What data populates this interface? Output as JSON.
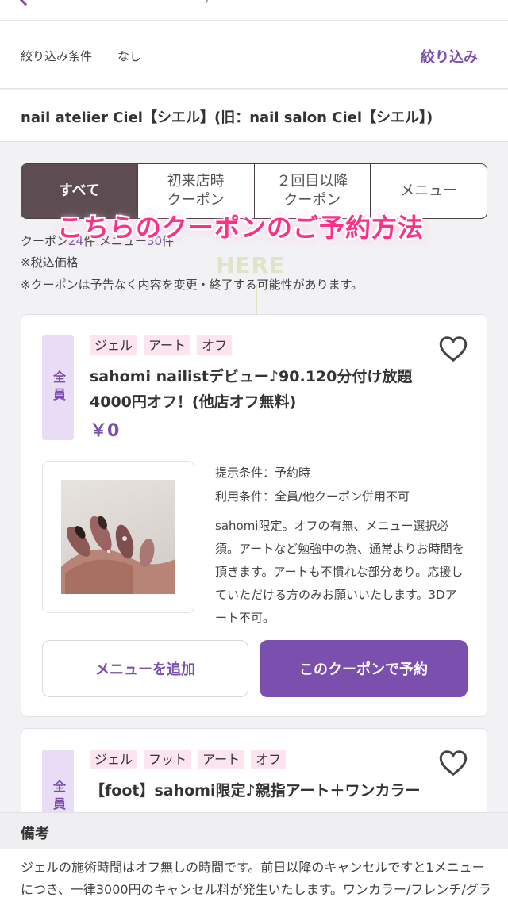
{
  "filter": {
    "label": "絞り込み条件",
    "value": "なし",
    "button": "絞り込み"
  },
  "salon": {
    "name": "nail atelier Ciel【シエル】(旧：nail salon Ciel【シエル】)"
  },
  "tabs": [
    {
      "label": "すべて",
      "active": true
    },
    {
      "label": "初来店時\nクーポン",
      "active": false
    },
    {
      "label": "２回目以降\nクーポン",
      "active": false
    },
    {
      "label": "メニュー",
      "active": false
    }
  ],
  "overlay": {
    "caption": "こちらのクーポンのご予約方法",
    "pointer": "HERE"
  },
  "counts": {
    "coupon_label": "クーポン",
    "coupon_num": "24",
    "coupon_unit": "件",
    "menu_label": "メニュー",
    "menu_num": "30",
    "menu_unit": "件"
  },
  "notes": [
    "※税込価格",
    "※クーポンは予告なく内容を変更・終了する可能性があります。"
  ],
  "coupons": [
    {
      "badge": "全員",
      "tags": [
        "ジェル",
        "アート",
        "オフ"
      ],
      "title": "sahomi nailistデビュー♪90.120分付け放題4000円オフ！(他店オフ無料)",
      "price": "￥0",
      "present_condition": "提示条件：予約時",
      "use_condition": "利用条件：全員/他クーポン併用不可",
      "description": "sahomi限定。オフの有無、メニュー選択必須。アートなど勉強中の為、通常よりお時間を頂きます。アートも不慣れな部分あり。応援していただける方のみお願いいたします。3Dアート不可。",
      "add_button": "メニューを追加",
      "reserve_button": "このクーポンで予約"
    },
    {
      "badge": "全員",
      "tags": [
        "ジェル",
        "フット",
        "アート",
        "オフ"
      ],
      "title": "【foot】sahomi限定♪親指アート＋ワンカラー"
    }
  ],
  "remarks": {
    "title": "備考",
    "text": "ジェルの施術時間はオフ無しの時間です。前日以降のキャンセルですと1メニューにつき、一律3000円のキャンセル料が発生いたします。ワンカラー/フレンチ/グラデーション/ニュアンス/パラジェル/付け放題/リクライニン"
  },
  "colors": {
    "accent": "#7a4fae",
    "tab_active": "#5d4c52",
    "tag_bg": "#fde4ef",
    "badge_bg": "#e9ddf5",
    "overlay_pink": "#ff2f86"
  }
}
